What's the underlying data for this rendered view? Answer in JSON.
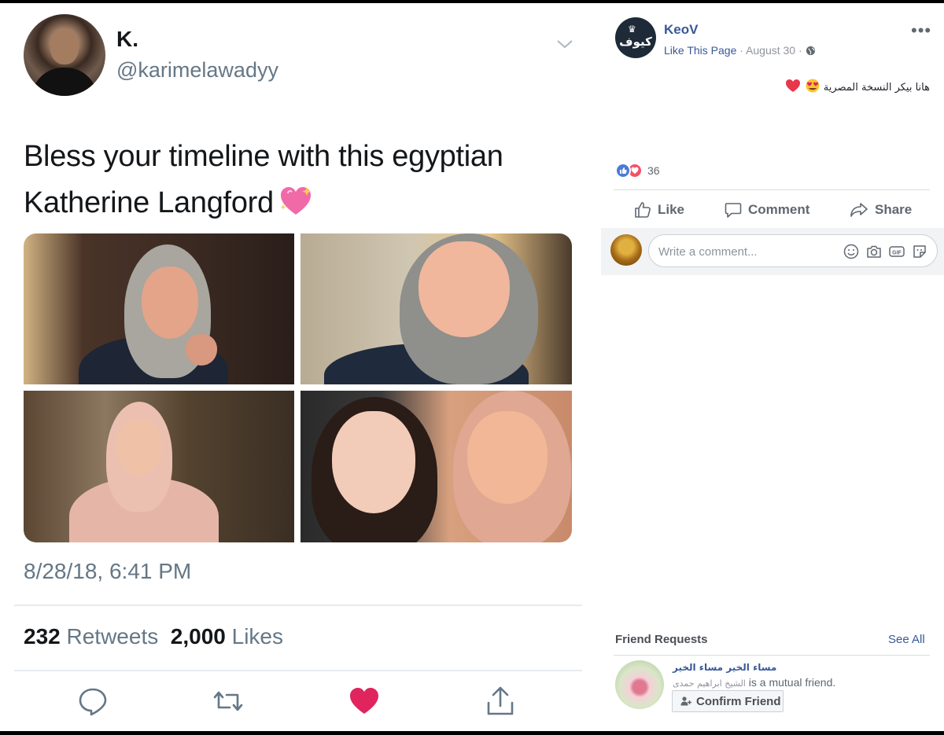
{
  "tweet": {
    "name": "K.",
    "handle": "@karimelawadyy",
    "text": "Bless your timeline with this egyptian Katherine Langford",
    "timestamp": "8/28/18, 6:41 PM",
    "retweets_count": "232",
    "retweets_label": "Retweets",
    "likes_count": "2,000",
    "likes_label": "Likes",
    "like_color": "#e0245e"
  },
  "facebook": {
    "page_name": "KeoV",
    "logo_text": "كيوف",
    "like_page_label": "Like This Page",
    "date": "August 30",
    "caption": "هانا بيكر النسخة المصرية",
    "reaction_count": "36",
    "actions": {
      "like": "Like",
      "comment": "Comment",
      "share": "Share"
    },
    "comment_placeholder": "Write a comment...",
    "friend_requests": {
      "title": "Friend Requests",
      "see_all": "See All",
      "name": "مساء الخير مساء الخير",
      "mutual_name": "الشيخ ابراهيم حمدى",
      "mutual_suffix": "is a mutual friend.",
      "confirm": "Confirm Friend"
    },
    "brand_color": "#385898"
  }
}
